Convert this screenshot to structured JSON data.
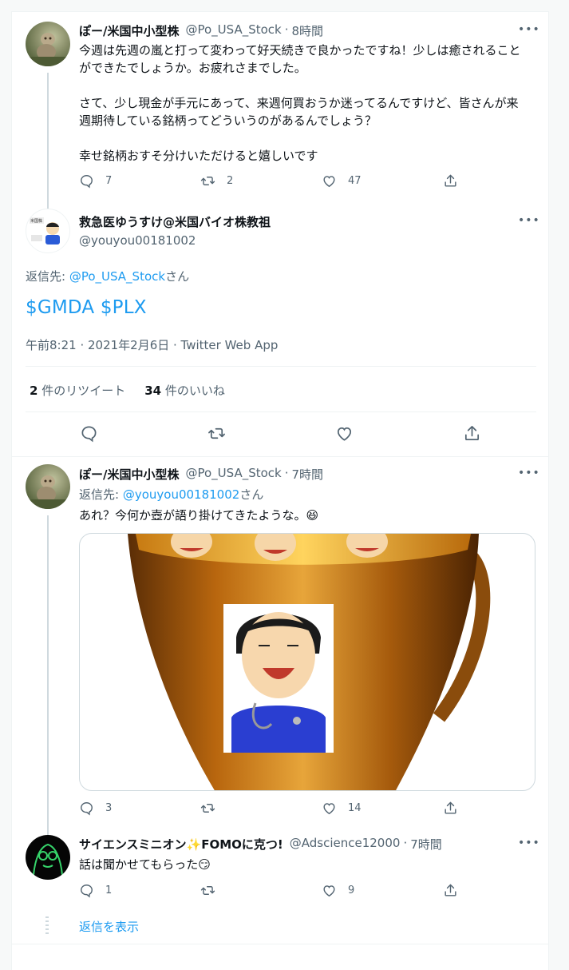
{
  "tweet1": {
    "name": "ぽー/米国中小型株",
    "handle": "@Po_USA_Stock",
    "time": "8時間",
    "para1": "今週は先週の嵐と打って変わって好天続きで良かったですね！少しは癒されることができたでしょうか。お疲れさまでした。",
    "para2": "さて、少し現金が手元にあって、来週何買おうか迷ってるんですけど、皆さんが来週期待している銘柄ってどういうのがあるんでしょう？",
    "para3": "幸せ銘柄おすそ分けいただけると嬉しいです",
    "replies": "7",
    "retweets": "2",
    "likes": "47",
    "icons": [
      "reply-icon",
      "retweet-icon",
      "like-icon",
      "share-icon"
    ]
  },
  "main_tweet": {
    "name": "救急医ゆうすけ@米国バイオ株教祖",
    "handle": "@youyou00181002",
    "reply_label": "返信先: ",
    "reply_handle": "@Po_USA_Stock",
    "reply_suffix": "さん",
    "body": "$GMDA $PLX",
    "timestamp": "午前8:21 · 2021年2月6日 · Twitter Web App",
    "retweet_count": "2",
    "retweet_label": " 件のリツイート",
    "like_count": "34",
    "like_label": " 件のいいね"
  },
  "tweet3": {
    "name": "ぽー/米国中小型株",
    "handle": "@Po_USA_Stock",
    "time": "7時間",
    "reply_label": "返信先: ",
    "reply_handle": "@youyou00181002",
    "reply_suffix": "さん",
    "body": "あれ？今何か壺が語り掛けてきたような。😆",
    "replies": "3",
    "retweets": "",
    "likes": "14"
  },
  "tweet4": {
    "name": "サイエンスミニオン✨FOMOに克つ!",
    "handle": "@Adscience12000",
    "time": "7時間",
    "body": "話は聞かせてもらった😏",
    "replies": "1",
    "retweets": "",
    "likes": "9"
  },
  "show_replies": "返信を表示",
  "separator": " · "
}
